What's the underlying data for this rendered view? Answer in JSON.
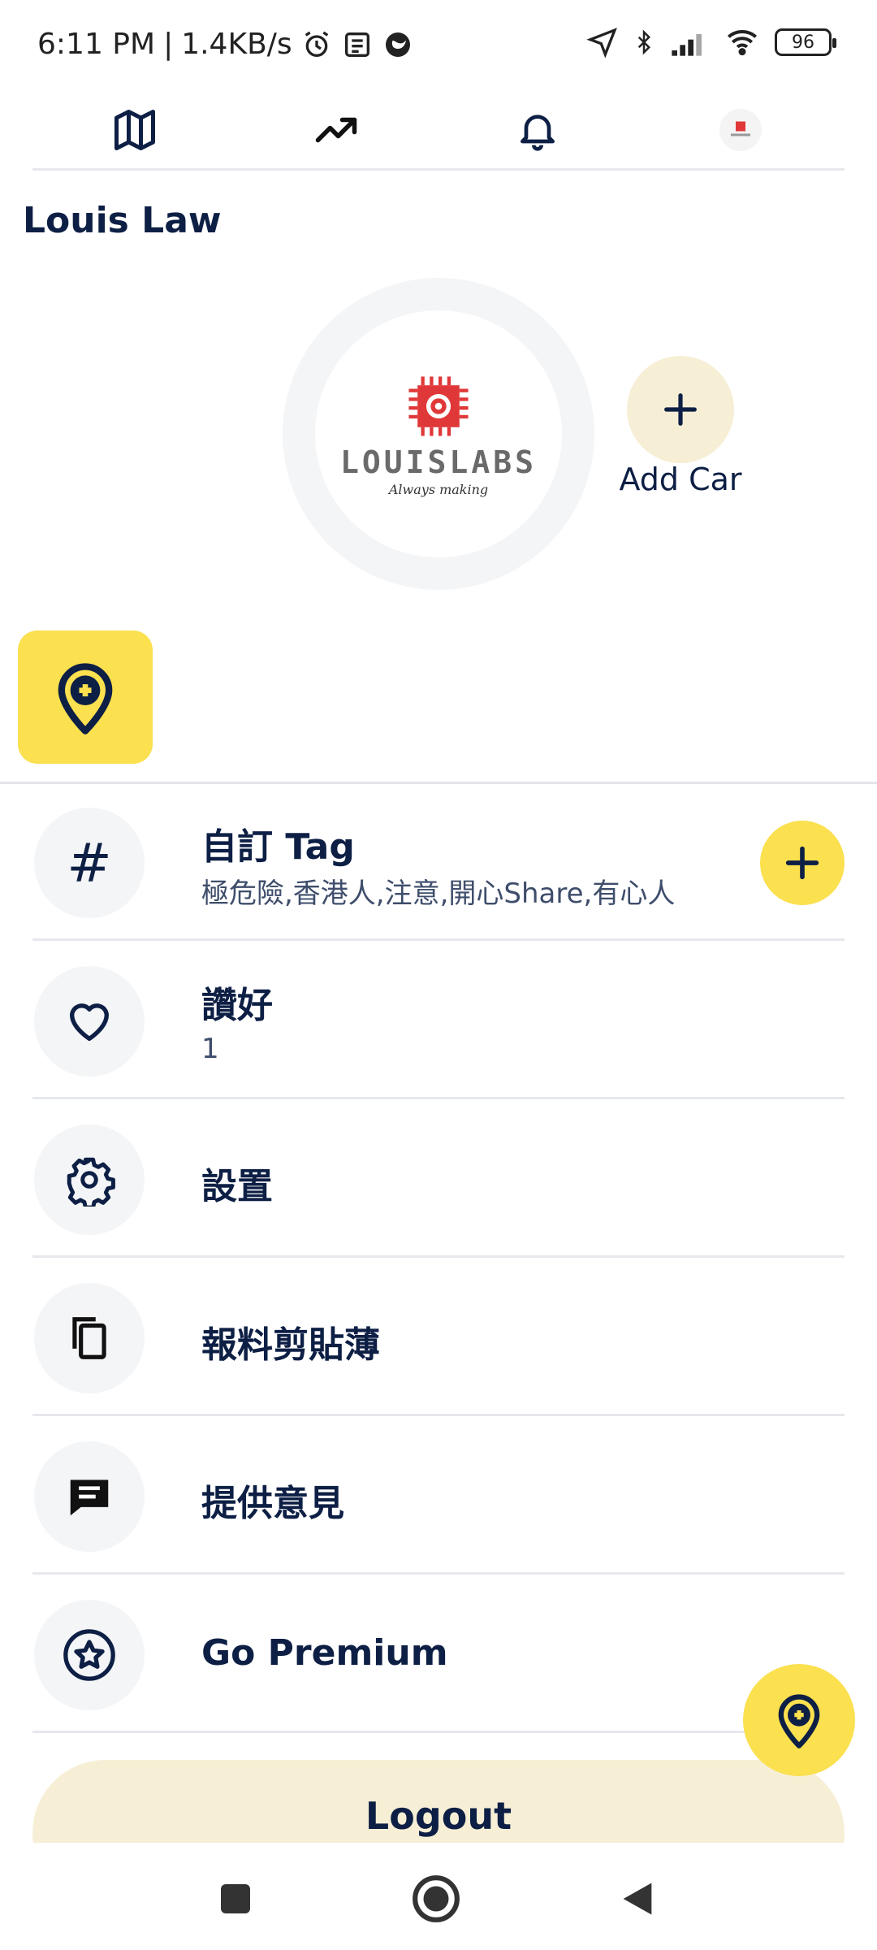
{
  "status_bar": {
    "time": "6:11 PM",
    "speed": "1.4KB/s",
    "separator": "|",
    "battery": "96"
  },
  "top_nav": {
    "items": [
      {
        "icon": "map-icon"
      },
      {
        "icon": "trending-icon"
      },
      {
        "icon": "bell-icon"
      },
      {
        "icon": "avatar"
      }
    ]
  },
  "profile": {
    "name": "Louis Law",
    "logo_text": "LOUISLABS",
    "logo_tagline": "Always making",
    "add_car_label": "Add Car"
  },
  "menu": {
    "tags": {
      "title": "自訂 Tag",
      "value": "極危險,香港人,注意,開心Share,有心人",
      "icon": "hash-icon"
    },
    "likes": {
      "title": "讚好",
      "value": "1",
      "icon": "heart-icon"
    },
    "settings": {
      "title": "設置",
      "icon": "gear-icon"
    },
    "clipboard": {
      "title": "報料剪貼薄",
      "icon": "copy-icon"
    },
    "feedback": {
      "title": "提供意見",
      "icon": "message-icon"
    },
    "premium": {
      "title": "Go Premium",
      "icon": "star-icon"
    }
  },
  "logout_label": "Logout",
  "colors": {
    "accent_yellow": "#fbe04f",
    "soft_yellow": "#f6efd6",
    "navy": "#0d1f44",
    "icon_bg": "#f4f5f7"
  }
}
